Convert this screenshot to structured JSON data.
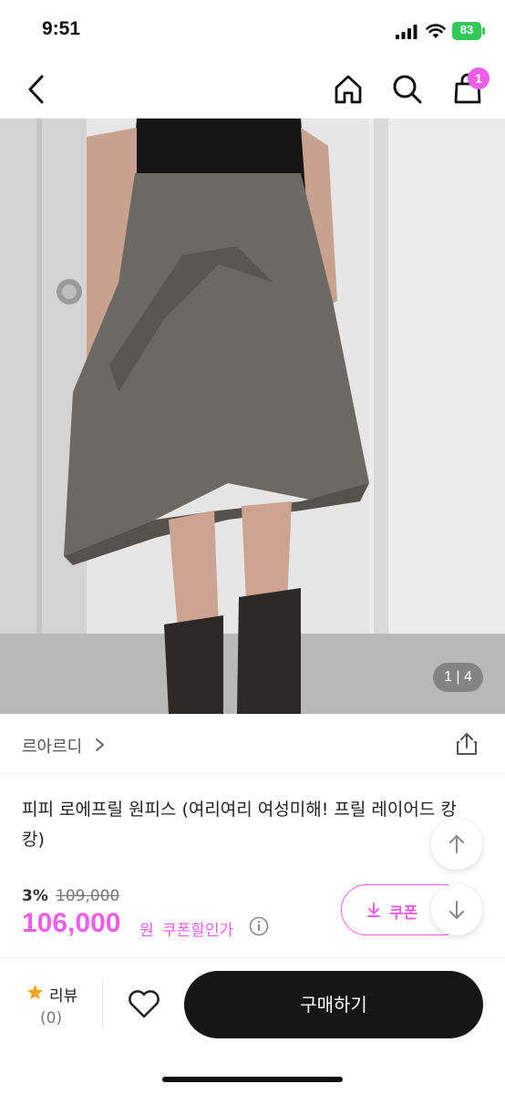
{
  "status_bar": {
    "time": "9:51",
    "battery_level": "83",
    "icons": [
      "signal-icon",
      "wifi-icon",
      "battery-icon"
    ]
  },
  "header": {
    "icons": [
      "back-chevron-icon",
      "home-icon",
      "search-icon",
      "shopping-bag-icon"
    ],
    "cart_count": "1"
  },
  "product": {
    "image_counter": "1 | 4",
    "brand": "르아르디",
    "title": "피피 로에프릴 원피스 (여리여리 여성미해! 프릴 레이어드 캉캉)",
    "discount_rate": "3%",
    "original_price": "109,000",
    "sale_price": "106,000",
    "currency_unit": "원",
    "coupon_text": "쿠폰할인가",
    "coupon_button": "쿠폰 ",
    "accent_color": "#ee5ee6"
  },
  "bottom_bar": {
    "review_label": "리뷰",
    "review_count": "(0)",
    "buy_label": "구매하기"
  }
}
